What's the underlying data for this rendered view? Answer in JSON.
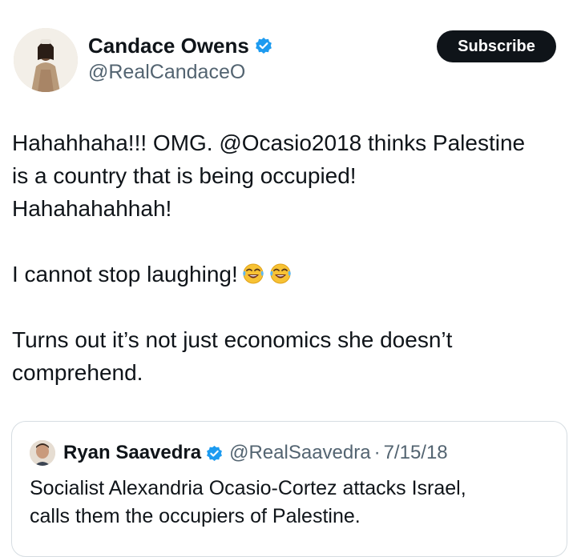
{
  "author": {
    "name": "Candace Owens",
    "handle": "@RealCandaceO",
    "verified_color": "#1d9bf0"
  },
  "actions": {
    "subscribe_label": "Subscribe"
  },
  "tweet": {
    "line1": "Hahahhaha!!! OMG. @Ocasio2018 thinks Palestine",
    "line2": "is a country that is being occupied!",
    "line3": "Hahahahahhah!",
    "line4": "I cannot stop laughing!",
    "line4_emojis": [
      "face-with-tears-of-joy-icon",
      "face-with-tears-of-joy-icon"
    ],
    "line5": "Turns out it’s not just economics she doesn’t",
    "line6": "comprehend."
  },
  "quoted": {
    "name": "Ryan Saavedra",
    "handle": "@RealSaavedra",
    "separator": "·",
    "date": "7/15/18",
    "text_line1": "Socialist Alexandria Ocasio-Cortez attacks Israel,",
    "text_line2": "calls them the occupiers of Palestine."
  }
}
